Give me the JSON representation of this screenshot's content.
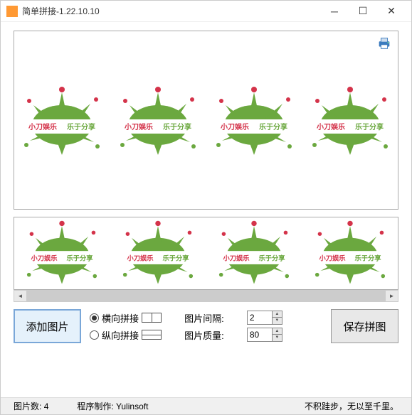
{
  "window": {
    "title": "简单拼接-1.22.10.10"
  },
  "buttons": {
    "add": "添加图片",
    "save": "保存拼图"
  },
  "options": {
    "horizontal": "横向拼接",
    "vertical": "纵向拼接",
    "spacing_label": "图片间隔:",
    "quality_label": "图片质量:",
    "spacing_value": "2",
    "quality_value": "80"
  },
  "status": {
    "count_label": "图片数:",
    "count_value": "4",
    "author": "程序制作: Yulinsoft",
    "motto": "不积跬步，无以至千里。"
  },
  "splash_text": {
    "left": "小刀娱乐",
    "right": "乐于分享"
  }
}
